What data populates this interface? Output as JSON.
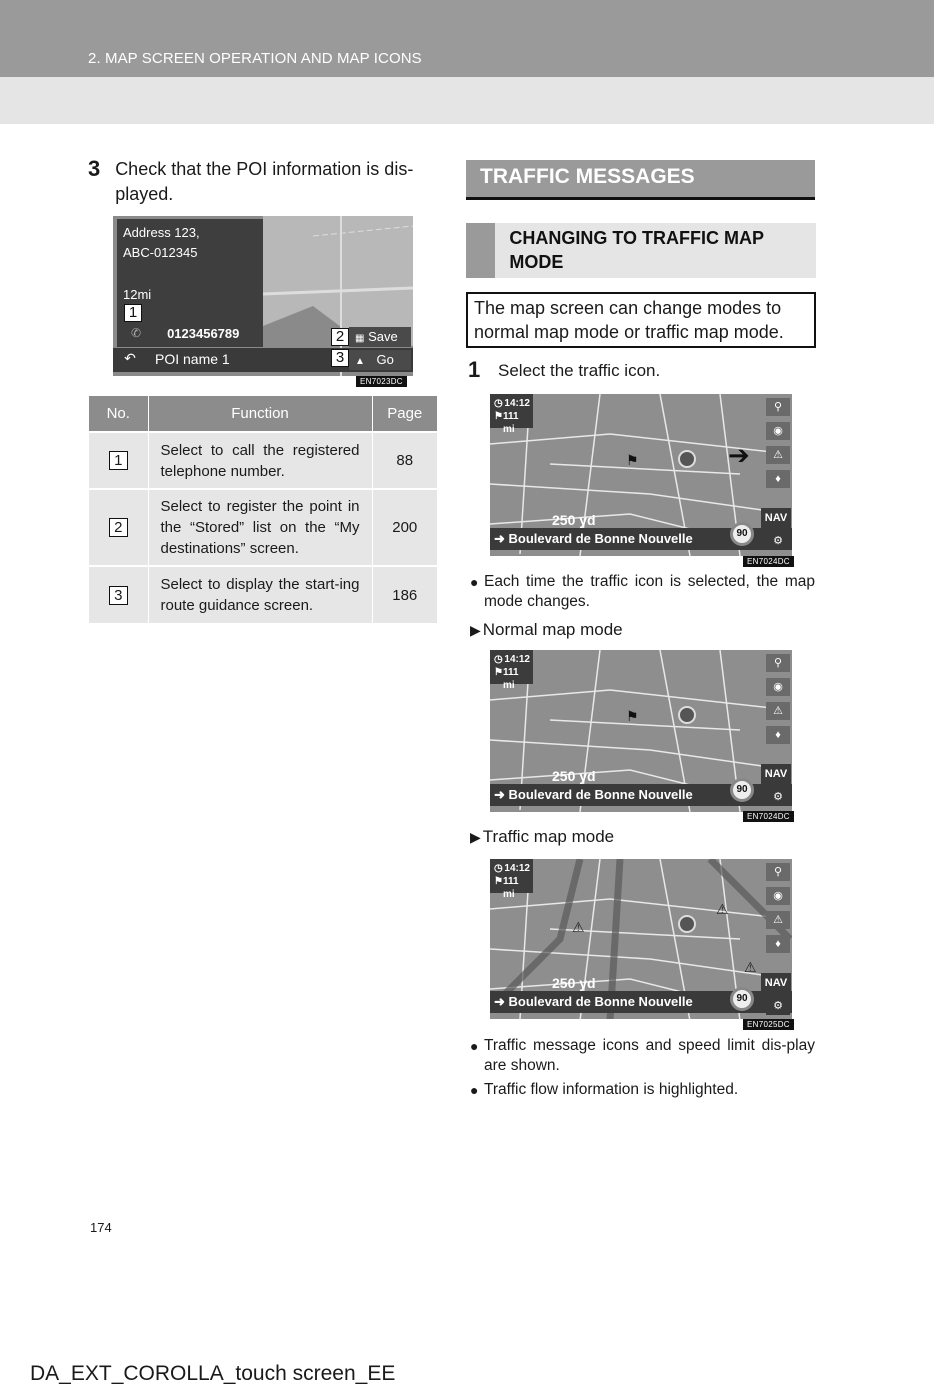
{
  "header": {
    "section_title": "2. MAP SCREEN OPERATION AND MAP ICONS"
  },
  "left": {
    "step": {
      "number": "3",
      "text": "Check that the POI information is dis-played."
    },
    "poi_screen": {
      "address_line1": "Address 123,",
      "address_line2": "ABC-012345",
      "distance": "12mi",
      "phone": "0123456789",
      "poi_name": "POI name 1",
      "save_label": "Save",
      "go_label": "Go",
      "back_icon": "back-arrow-icon",
      "phone_icon": "phone-icon",
      "save_icon": "save-disk-icon",
      "go_icon": "navigate-icon",
      "callouts": [
        "1",
        "2",
        "3"
      ],
      "code": "EN7023DC"
    },
    "table": {
      "headers": {
        "no": "No.",
        "function": "Function",
        "page": "Page"
      },
      "rows": [
        {
          "no": "1",
          "function": "Select to call the registered telephone number.",
          "page": "88"
        },
        {
          "no": "2",
          "function": "Select to register the point in the “Stored” list on the “My destinations” screen.",
          "page": "200"
        },
        {
          "no": "3",
          "function": "Select to display the start-ing route guidance screen.",
          "page": "186"
        }
      ]
    }
  },
  "right": {
    "section_header": "TRAFFIC MESSAGES",
    "sub_header": "CHANGING TO TRAFFIC MAP MODE",
    "intro": "The map screen can change modes to normal map mode or traffic map mode.",
    "step": {
      "number": "1",
      "text": "Select the traffic icon."
    },
    "nav_screen": {
      "time": "14:12",
      "distance_remaining": "111 mi",
      "turn_distance": "250 yd",
      "street": "Boulevard de Bonne Nouvelle",
      "speed_limit": "90",
      "nav_label": "NAV",
      "codes": [
        "EN7024DC",
        "EN7024DC",
        "EN7025DC"
      ]
    },
    "bullet1": "Each time the traffic icon is selected, the map mode changes.",
    "mode_normal": "Normal map mode",
    "mode_traffic": "Traffic map mode",
    "bullet2": "Traffic message icons and speed limit dis-play are shown.",
    "bullet3": "Traffic flow information is highlighted."
  },
  "footer": {
    "page_number": "174",
    "doc_id": "DA_EXT_COROLLA_touch screen_EE"
  }
}
